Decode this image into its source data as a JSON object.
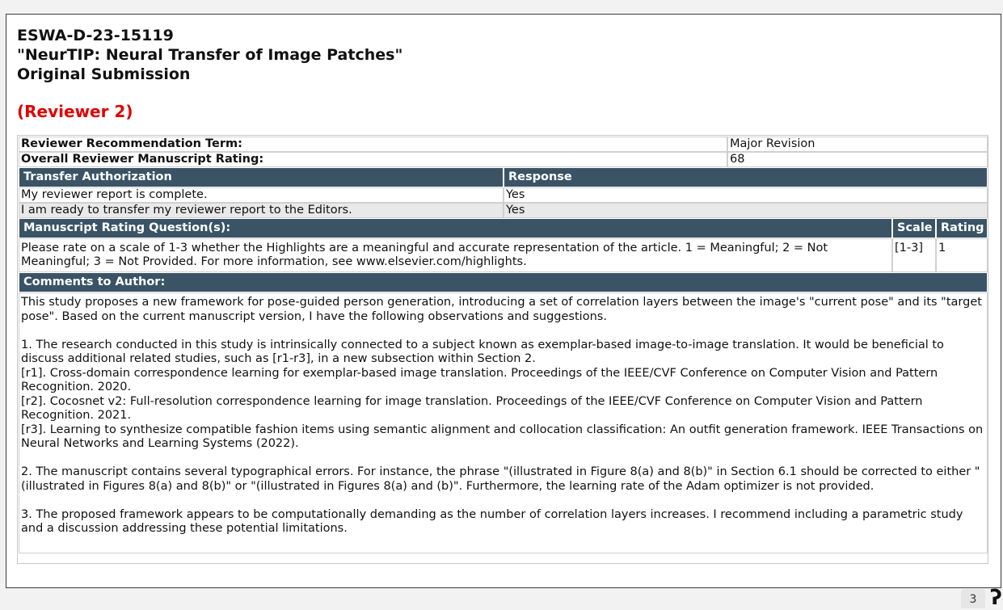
{
  "header": {
    "manuscript_id": "ESWA-D-23-15119",
    "title": "\"NeurTIP: Neural Transfer of Image Patches\"",
    "submission": "Original Submission"
  },
  "reviewer": "(Reviewer 2)",
  "summary": {
    "recommendation_label": "Reviewer Recommendation Term:",
    "recommendation_value": "Major Revision",
    "rating_label": "Overall Reviewer Manuscript Rating:",
    "rating_value": "68"
  },
  "transfer": {
    "header": "Transfer Authorization",
    "response_header": "Response",
    "rows": [
      {
        "question": "My reviewer report is complete.",
        "answer": "Yes"
      },
      {
        "question": "I am ready to transfer my reviewer report to the Editors.",
        "answer": "Yes"
      }
    ]
  },
  "rating_questions": {
    "header": "Manuscript Rating Question(s):",
    "scale_header": "Scale",
    "rating_header": "Rating",
    "rows": [
      {
        "question": "Please rate on a scale of 1-3 whether the Highlights are a meaningful and accurate representation of the article. 1 = Meaningful; 2 = Not Meaningful; 3 = Not Provided. For more information, see www.elsevier.com/highlights.",
        "scale": "[1-3]",
        "rating": "1"
      }
    ]
  },
  "comments": {
    "header": "Comments to Author:",
    "intro": "This study proposes a new framework for pose-guided person generation, introducing a set of correlation layers between the image's \"current pose\" and its \"target pose\". Based on the current manuscript version, I have the following observations and suggestions.",
    "point1": "1. The research conducted in this study is intrinsically connected to a subject known as exemplar-based image-to-image translation. It would be beneficial to discuss additional related studies, such as [r1-r3], in a new subsection within Section 2.",
    "ref1": "[r1]. Cross-domain correspondence learning for exemplar-based image translation. Proceedings of the IEEE/CVF Conference on Computer Vision and Pattern Recognition. 2020.",
    "ref2": "[r2]. Cocosnet v2: Full-resolution correspondence learning for image translation. Proceedings of the IEEE/CVF Conference on Computer Vision and Pattern Recognition. 2021.",
    "ref3": "[r3]. Learning to synthesize compatible fashion items using semantic alignment and collocation classification: An outfit generation framework. IEEE Transactions on Neural Networks and Learning Systems (2022).",
    "point2": "2. The manuscript contains several typographical errors. For instance, the phrase \"(illustrated in Figure 8(a) and 8(b)\" in Section 6.1 should be corrected to either \"(illustrated in Figures 8(a) and 8(b)\" or \"(illustrated in Figures 8(a) and (b)\". Furthermore, the learning rate of the Adam optimizer is not provided.",
    "point3": "3. The proposed framework appears to be computationally demanding as the number of correlation layers increases. I recommend including a parametric study and a discussion addressing these potential limitations."
  },
  "page_number": "3",
  "colors": {
    "header_bg": "#3a5466",
    "reviewer_red": "#e00000",
    "alt_row": "#e9e9e9"
  }
}
